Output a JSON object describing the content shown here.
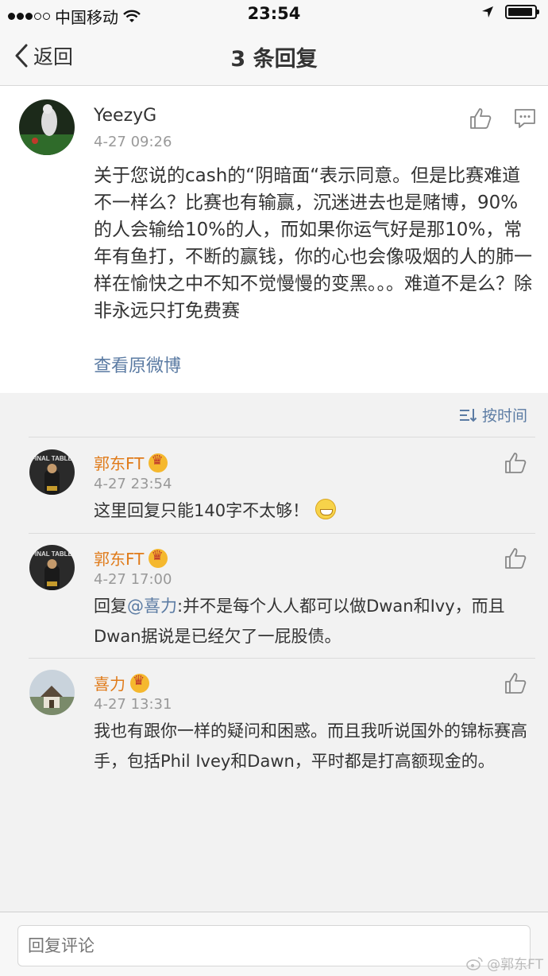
{
  "status": {
    "carrier": "中国移动",
    "time": "23:54"
  },
  "nav": {
    "back_label": "返回",
    "title": "3 条回复"
  },
  "post": {
    "author": "YeezyG",
    "time": "4-27 09:26",
    "text": "关于您说的cash的“阴暗面“表示同意。但是比赛难道不一样么？比赛也有输赢，沉迷进去也是赌博，90%的人会输给10%的人，而如果你运气好是那10%，常年有鱼打，不断的赢钱，你的心也会像吸烟的人的肺一样在愉快之中不知不觉慢慢的变黑。。。难道不是么？除非永远只打免费赛",
    "view_original": "查看原微博"
  },
  "sort_label": "按时间",
  "replies": [
    {
      "name": "郭东FT",
      "time": "4-27 23:54",
      "text": "这里回复只能140字不太够！"
    },
    {
      "name": "郭东FT",
      "time": "4-27 17:00",
      "prefix": "回复",
      "mention": "@喜力",
      "text": ":并不是每个人人都可以做Dwan和Ivy，而且Dwan据说是已经欠了一屁股债。"
    },
    {
      "name": "喜力",
      "time": "4-27 13:31",
      "text": "我也有跟你一样的疑问和困惑。而且我听说国外的锦标赛高手，包括Phil Ivey和Dawn，平时都是打高额现金的。"
    }
  ],
  "input": {
    "placeholder": "回复评论"
  },
  "watermark": "@郭东FT",
  "colors": {
    "link": "#5b7ba3",
    "name_orange": "#e07b1a"
  }
}
